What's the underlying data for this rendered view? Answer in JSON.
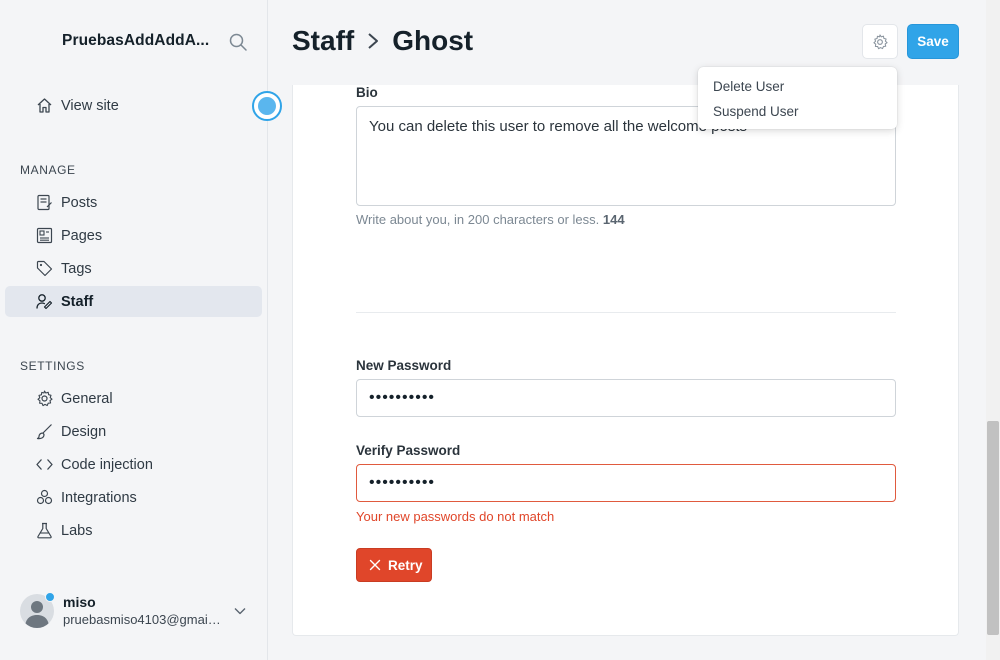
{
  "sidebar": {
    "brand": "PruebasAddAddA...",
    "view_site": "View site",
    "manage_label": "MANAGE",
    "settings_label": "SETTINGS",
    "manage_items": [
      {
        "label": "Posts",
        "icon": "posts-icon"
      },
      {
        "label": "Pages",
        "icon": "pages-icon"
      },
      {
        "label": "Tags",
        "icon": "tag-icon"
      },
      {
        "label": "Staff",
        "icon": "staff-icon",
        "active": true
      }
    ],
    "settings_items": [
      {
        "label": "General",
        "icon": "gear-icon"
      },
      {
        "label": "Design",
        "icon": "brush-icon"
      },
      {
        "label": "Code injection",
        "icon": "code-icon"
      },
      {
        "label": "Integrations",
        "icon": "integrations-icon"
      },
      {
        "label": "Labs",
        "icon": "flask-icon"
      }
    ],
    "user": {
      "name": "miso",
      "email": "pruebasmiso4103@gmail...."
    }
  },
  "header": {
    "breadcrumb_parent": "Staff",
    "breadcrumb_current": "Ghost",
    "save_label": "Save"
  },
  "dropdown": {
    "items": [
      "Delete User",
      "Suspend User"
    ]
  },
  "form": {
    "bio_label": "Bio",
    "bio_value": "You can delete this user to remove all the welcome posts",
    "bio_hint": "Write about you, in 200 characters or less.",
    "bio_count": "144",
    "new_password_label": "New Password",
    "new_password_value": "••••••••••",
    "verify_password_label": "Verify Password",
    "verify_password_value": "••••••••••",
    "error_message": "Your new passwords do not match",
    "retry_label": "Retry"
  },
  "colors": {
    "accent": "#30a4e8",
    "error": "#e0462a"
  }
}
